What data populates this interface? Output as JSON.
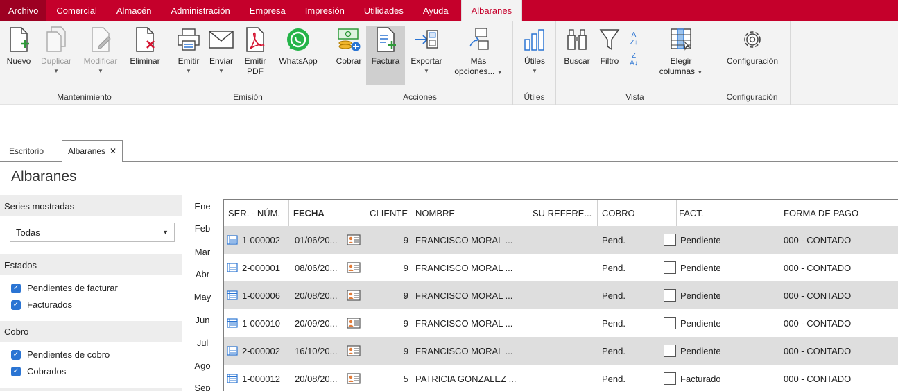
{
  "menu": {
    "items": [
      "Archivo",
      "Comercial",
      "Almacén",
      "Administración",
      "Empresa",
      "Impresión",
      "Utilidades",
      "Ayuda",
      "Albaranes"
    ]
  },
  "ribbon": {
    "groups": {
      "mantenimiento": "Mantenimiento",
      "emision": "Emisión",
      "acciones": "Acciones",
      "utiles": "Útiles",
      "vista": "Vista",
      "configuracion": "Configuración"
    },
    "buttons": {
      "nuevo": "Nuevo",
      "duplicar": "Duplicar",
      "modificar": "Modificar",
      "eliminar": "Eliminar",
      "emitir": "Emitir",
      "enviar": "Enviar",
      "emitir_pdf_1": "Emitir",
      "emitir_pdf_2": "PDF",
      "whatsapp": "WhatsApp",
      "cobrar": "Cobrar",
      "factura": "Factura",
      "exportar": "Exportar",
      "mas_1": "Más",
      "mas_2": "opciones...",
      "utiles": "Útiles",
      "buscar": "Buscar",
      "filtro": "Filtro",
      "elegir_1": "Elegir",
      "elegir_2": "columnas",
      "configuracion": "Configuración"
    }
  },
  "tabs": {
    "escritorio": "Escritorio",
    "albaranes": "Albaranes",
    "close": "✕"
  },
  "page_title": "Albaranes",
  "filters": {
    "series_header": "Series mostradas",
    "series_value": "Todas",
    "estados_header": "Estados",
    "estados": [
      "Pendientes de facturar",
      "Facturados"
    ],
    "cobro_header": "Cobro",
    "cobro": [
      "Pendientes de cobro",
      "Cobrados"
    ]
  },
  "months": [
    "Ene",
    "Feb",
    "Mar",
    "Abr",
    "May",
    "Jun",
    "Jul",
    "Ago",
    "Sep"
  ],
  "table": {
    "headers": {
      "sernum": "SER. - NÚM.",
      "fecha": "FECHA",
      "cliente": "CLIENTE",
      "nombre": "NOMBRE",
      "suref": "SU REFERE...",
      "cobro": "COBRO",
      "fact": "FACT.",
      "forma": "FORMA DE PAGO"
    },
    "rows": [
      {
        "sernum": "1-000002",
        "fecha": "01/06/20...",
        "cliente": "9",
        "nombre": "FRANCISCO MORAL ...",
        "cobro": "Pend.",
        "fact": "Pendiente",
        "forma": "000 - CONTADO"
      },
      {
        "sernum": "2-000001",
        "fecha": "08/06/20...",
        "cliente": "9",
        "nombre": "FRANCISCO MORAL ...",
        "cobro": "Pend.",
        "fact": "Pendiente",
        "forma": "000 - CONTADO"
      },
      {
        "sernum": "1-000006",
        "fecha": "20/08/20...",
        "cliente": "9",
        "nombre": "FRANCISCO MORAL ...",
        "cobro": "Pend.",
        "fact": "Pendiente",
        "forma": "000 - CONTADO"
      },
      {
        "sernum": "1-000010",
        "fecha": "20/09/20...",
        "cliente": "9",
        "nombre": "FRANCISCO MORAL ...",
        "cobro": "Pend.",
        "fact": "Pendiente",
        "forma": "000 - CONTADO"
      },
      {
        "sernum": "2-000002",
        "fecha": "16/10/20...",
        "cliente": "9",
        "nombre": "FRANCISCO MORAL ...",
        "cobro": "Pend.",
        "fact": "Pendiente",
        "forma": "000 - CONTADO"
      },
      {
        "sernum": "1-000012",
        "fecha": "20/08/20...",
        "cliente": "5",
        "nombre": "PATRICIA GONZALEZ ...",
        "cobro": "Pend.",
        "fact": "Facturado",
        "forma": "000 - CONTADO"
      }
    ]
  },
  "colors": {
    "brand": "#c5002b",
    "checkbox": "#2a74d3",
    "alt_row": "#dedede"
  }
}
